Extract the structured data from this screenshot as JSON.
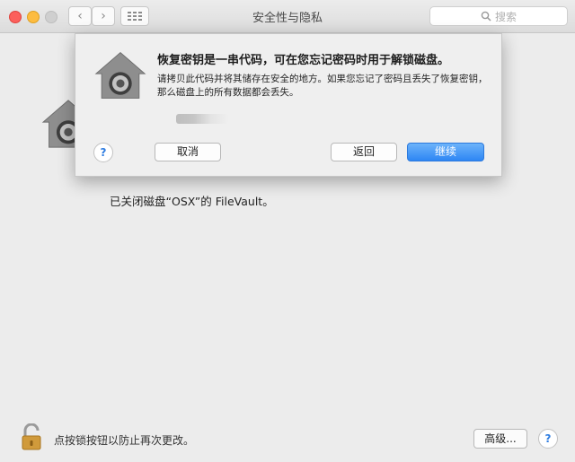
{
  "window": {
    "title": "安全性与隐私",
    "back_glyph": "‹",
    "forward_glyph": "›"
  },
  "search": {
    "placeholder": "搜索",
    "icon": "search-icon"
  },
  "sheet": {
    "title": "恢复密钥是一串代码，可在您忘记密码时用于解锁磁盘。",
    "message": "请拷贝此代码并将其储存在安全的地方。如果您忘记了密码且丢失了恢复密钥，那么磁盘上的所有数据都会丢失。",
    "help_label": "?",
    "cancel_label": "取消",
    "back_label": "返回",
    "continue_label": "继续"
  },
  "main": {
    "status_text": "已关闭磁盘“OSX”的 FileVault。"
  },
  "footer": {
    "lock_text": "点按锁按钮以防止再次更改。",
    "advanced_label": "高级...",
    "help_label": "?"
  },
  "colors": {
    "accent": "#2e86f4",
    "close": "#fc605c",
    "minimize": "#fdbc40",
    "lock_gold": "#d09a3b"
  }
}
